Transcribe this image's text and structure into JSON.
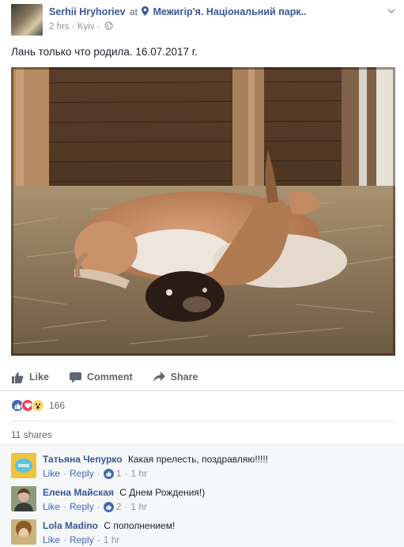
{
  "post": {
    "author": "Serhii Hryhoriev",
    "at": "at",
    "location": "Межигір'я. Національний парк..",
    "time": "2 hrs",
    "place": "Kyiv",
    "text": "Лань только что родила. 16.07.2017 г."
  },
  "actions": {
    "like": "Like",
    "comment": "Comment",
    "share": "Share"
  },
  "reactions": {
    "count": "166",
    "types": [
      "like",
      "love",
      "wow"
    ]
  },
  "shares": "11 shares",
  "comments": [
    {
      "name": "Татьяна Чепурко",
      "text": "Какая прелесть, поздравляю!!!!!",
      "like": "Like",
      "reply": "Reply",
      "likes": "1",
      "time": "1 hr"
    },
    {
      "name": "Елена Майская",
      "text": "С Днем Рождения!)",
      "like": "Like",
      "reply": "Reply",
      "likes": "2",
      "time": "1 hr"
    },
    {
      "name": "Lola Madino",
      "text": "С пополнением!",
      "like": "Like",
      "reply": "Reply",
      "time": "1 hr"
    }
  ],
  "colors": {
    "link": "#365899",
    "action": "#4267b2",
    "muted": "#90949c"
  }
}
